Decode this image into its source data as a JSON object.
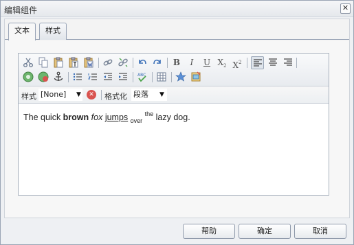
{
  "dialog": {
    "title": "编辑组件"
  },
  "tabs": [
    {
      "label": "文本"
    },
    {
      "label": "样式"
    }
  ],
  "toolbar": {
    "icons": [
      "cut-icon",
      "copy-icon",
      "paste-icon",
      "paste-text-icon",
      "paste-word-icon",
      "link-icon",
      "unlink-icon",
      "undo-icon",
      "redo-icon",
      "bold-icon",
      "italic-icon",
      "underline-icon",
      "subscript-icon",
      "superscript-icon",
      "align-left-icon",
      "align-center-icon",
      "align-right-icon",
      "anchor-icon",
      "bullet-list-icon",
      "numbered-list-icon",
      "outdent-icon",
      "indent-icon",
      "spellcheck-icon",
      "table-icon",
      "special-char-icon",
      "image-icon"
    ]
  },
  "stylebar": {
    "style_label": "样式",
    "style_value": "[None]",
    "format_label": "格式化",
    "format_value": "段落"
  },
  "content": {
    "t1": "The quick ",
    "t2": "brown",
    "t3": " ",
    "t4": "fox",
    "t5": " ",
    "t6": "jumps",
    "t7": " ",
    "t8": "over",
    "t9": " ",
    "t10": "the",
    "t11": " lazy dog."
  },
  "footer": {
    "help": "帮助",
    "ok": "确定",
    "cancel": "取消"
  }
}
